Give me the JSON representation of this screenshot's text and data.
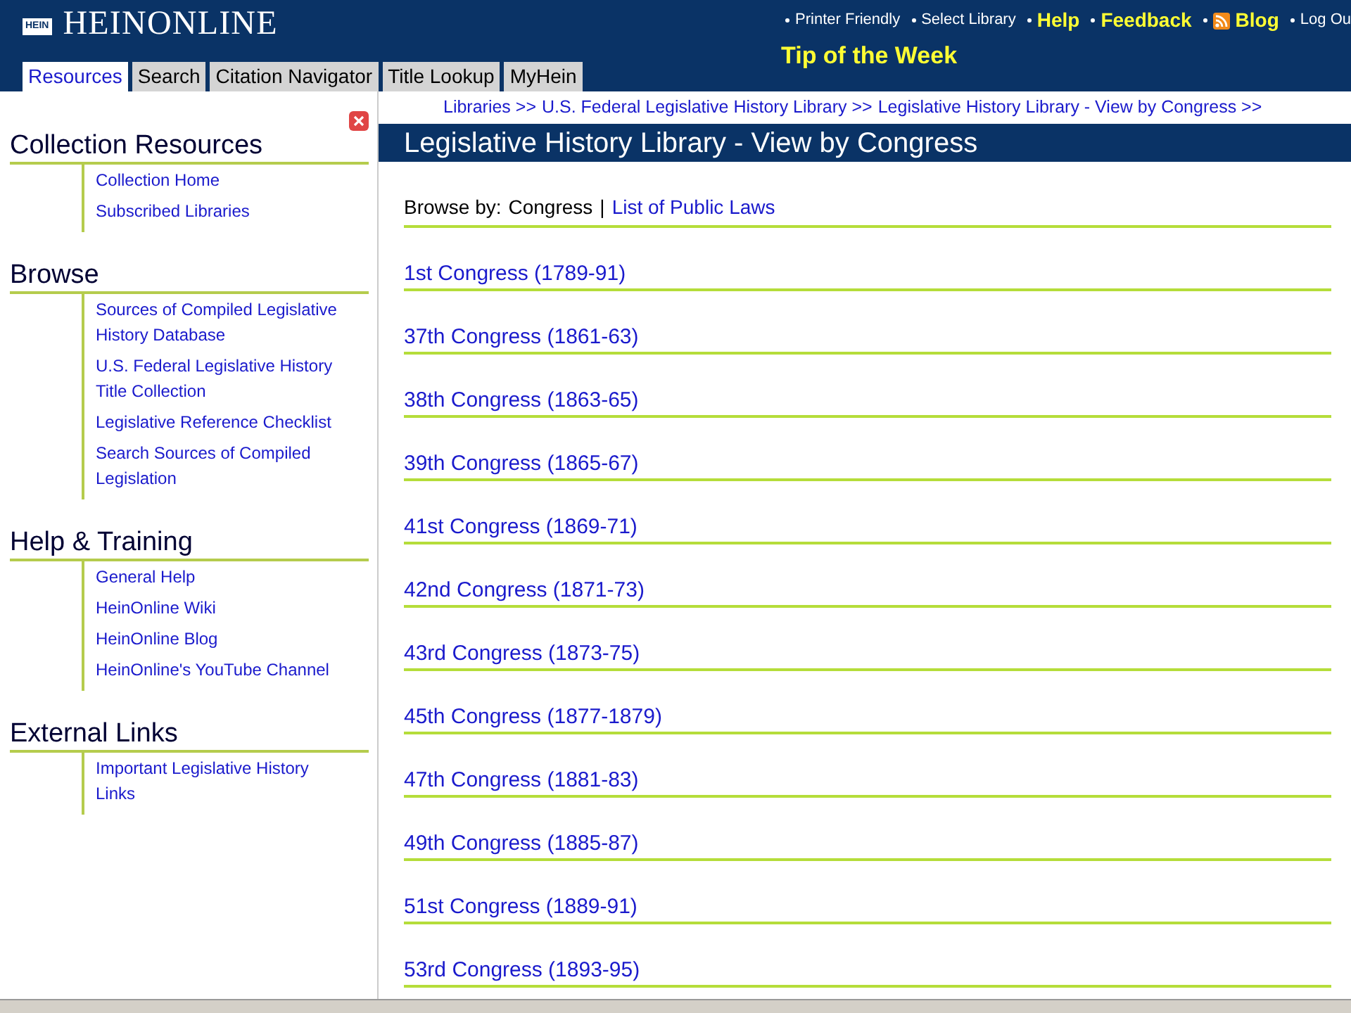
{
  "header": {
    "logo": "HEINONLINE",
    "logo_badge": "HEIN",
    "nav_links": [
      {
        "kind": "small",
        "label": "Printer Friendly"
      },
      {
        "kind": "small",
        "label": "Select Library"
      },
      {
        "kind": "bold",
        "label": "Help"
      },
      {
        "kind": "bold",
        "label": "Feedback"
      },
      {
        "kind": "feed",
        "label": "Blog"
      },
      {
        "kind": "small",
        "label": "Log Ou"
      }
    ],
    "tip": "Tip of the Week"
  },
  "tabs": [
    {
      "label": "Resources",
      "selected": true
    },
    {
      "label": "Search",
      "selected": false
    },
    {
      "label": "Citation Navigator",
      "selected": false
    },
    {
      "label": "Title Lookup",
      "selected": false
    },
    {
      "label": "MyHein",
      "selected": false
    }
  ],
  "sidebar": {
    "sections": [
      {
        "heading": "Collection Resources",
        "links": [
          "Collection Home",
          "Subscribed Libraries"
        ]
      },
      {
        "heading": "Browse",
        "links": [
          "Sources of Compiled Legislative History Database",
          "U.S. Federal Legislative History Title Collection",
          "Legislative Reference Checklist",
          "Search Sources of Compiled Legislation"
        ]
      },
      {
        "heading": "Help & Training",
        "links": [
          "General Help",
          "HeinOnline Wiki",
          "HeinOnline Blog",
          "HeinOnline's YouTube Channel"
        ]
      },
      {
        "heading": "External Links",
        "links": [
          "Important Legislative History Links"
        ]
      }
    ]
  },
  "breadcrumb": [
    "Libraries >>",
    "U.S. Federal Legislative History Library >>",
    "Legislative History Library - View by Congress >>"
  ],
  "page_title": "Legislative History Library - View by Congress",
  "browse_by": {
    "label": "Browse by:",
    "options": [
      {
        "label": "Congress",
        "selected": true
      },
      {
        "label": "List of Public Laws",
        "selected": false
      }
    ],
    "separator": "|"
  },
  "congresses": [
    "1st Congress (1789-91)",
    "37th Congress (1861-63)",
    "38th Congress (1863-65)",
    "39th Congress (1865-67)",
    "41st Congress (1869-71)",
    "42nd Congress (1871-73)",
    "43rd Congress (1873-75)",
    "45th Congress (1877-1879)",
    "47th Congress (1881-83)",
    "49th Congress (1885-87)",
    "51st Congress (1889-91)",
    "53rd Congress (1893-95)"
  ]
}
